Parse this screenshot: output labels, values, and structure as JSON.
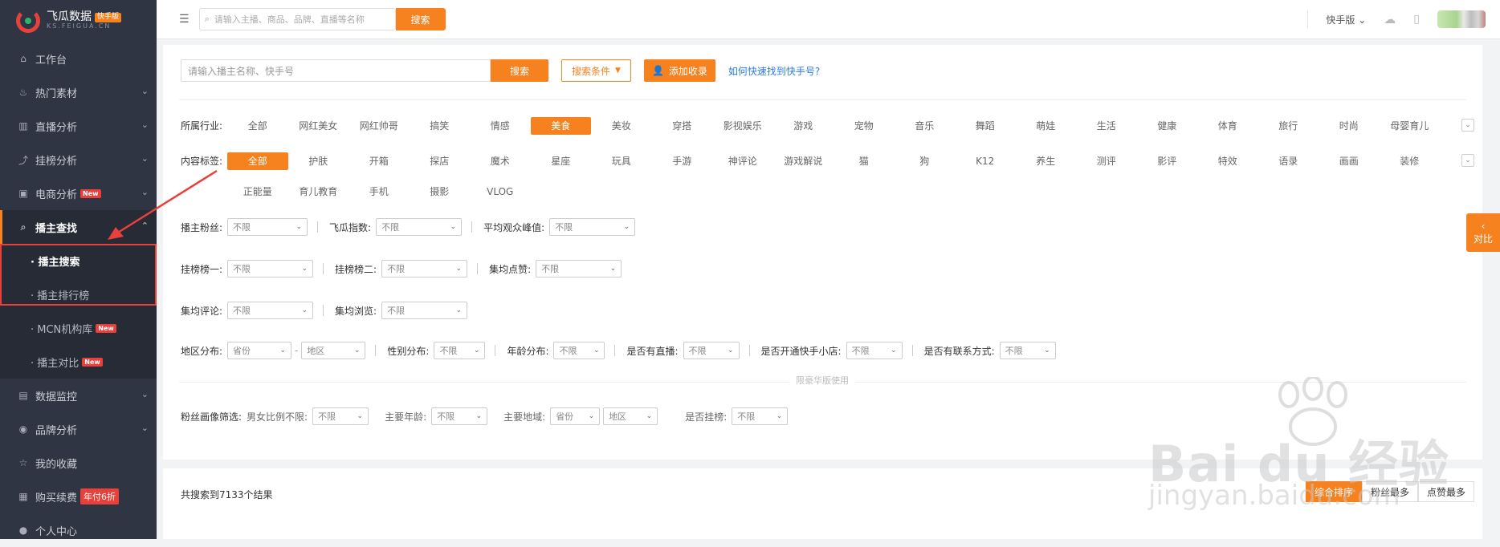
{
  "logo": {
    "title": "飞瓜数据",
    "badge": "快手版",
    "sub": "KS.FEIGUA.CN"
  },
  "sidebar": {
    "items": [
      {
        "label": "工作台",
        "icon": "home-icon",
        "chevron": false
      },
      {
        "label": "热门素材",
        "icon": "flame-icon",
        "chevron": true
      },
      {
        "label": "直播分析",
        "icon": "bar-chart-icon",
        "chevron": true
      },
      {
        "label": "挂榜分析",
        "icon": "trend-icon",
        "chevron": true
      },
      {
        "label": "电商分析",
        "icon": "shop-icon",
        "chevron": true,
        "badge": "New"
      },
      {
        "label": "播主查找",
        "icon": "search-icon",
        "chevron": true,
        "active": true
      }
    ],
    "sub_items": [
      {
        "label": "· 播主搜索",
        "current": true
      },
      {
        "label": "· 播主排行榜"
      },
      {
        "label": "· MCN机构库",
        "badge": "New"
      },
      {
        "label": "· 播主对比",
        "badge": "New"
      }
    ],
    "items2": [
      {
        "label": "数据监控",
        "icon": "monitor-icon",
        "chevron": true
      },
      {
        "label": "品牌分析",
        "icon": "brand-icon",
        "chevron": true
      },
      {
        "label": "我的收藏",
        "icon": "star-icon"
      },
      {
        "label": "购买续费",
        "icon": "cart-icon",
        "badge": "年付6折"
      },
      {
        "label": "个人中心",
        "icon": "user-icon"
      }
    ]
  },
  "topbar": {
    "search_placeholder": "请输入主播、商品、品牌、直播等名称",
    "search_button": "搜索",
    "version": "快手版"
  },
  "search": {
    "placeholder": "请输入播主名称、快手号",
    "button": "搜索",
    "condition_button": "搜索条件",
    "fav_button": "添加收录",
    "help_link": "如何快速找到快手号?"
  },
  "industry": {
    "label": "所属行业:",
    "tags": [
      "全部",
      "网红美女",
      "网红帅哥",
      "搞笑",
      "情感",
      "美食",
      "美妆",
      "穿搭",
      "影视娱乐",
      "游戏",
      "宠物",
      "音乐",
      "舞蹈",
      "萌娃",
      "生活",
      "健康",
      "体育",
      "旅行",
      "时尚",
      "母婴育儿"
    ],
    "selected": 5
  },
  "content_tags": {
    "label": "内容标签:",
    "tags": [
      "全部",
      "护肤",
      "开箱",
      "探店",
      "魔术",
      "星座",
      "玩具",
      "手游",
      "神评论",
      "游戏解说",
      "猫",
      "狗",
      "K12",
      "养生",
      "测评",
      "影评",
      "特效",
      "语录",
      "画画",
      "装修",
      "正能量",
      "育儿教育",
      "手机",
      "摄影",
      "VLOG"
    ],
    "selected": 0
  },
  "filters": {
    "fans": {
      "label": "播主粉丝:",
      "value": "不限"
    },
    "index": {
      "label": "飞瓜指数:",
      "value": "不限"
    },
    "peak": {
      "label": "平均观众峰值:",
      "value": "不限"
    },
    "rank1": {
      "label": "挂榜榜一:",
      "value": "不限"
    },
    "rank2": {
      "label": "挂榜榜二:",
      "value": "不限"
    },
    "likes": {
      "label": "集均点赞:",
      "value": "不限"
    },
    "comments": {
      "label": "集均评论:",
      "value": "不限"
    },
    "views": {
      "label": "集均浏览:",
      "value": "不限"
    },
    "region": {
      "label": "地区分布:",
      "province": "省份",
      "city": "地区"
    },
    "gender": {
      "label": "性别分布:",
      "value": "不限"
    },
    "age": {
      "label": "年龄分布:",
      "value": "不限"
    },
    "live": {
      "label": "是否有直播:",
      "value": "不限"
    },
    "shop": {
      "label": "是否开通快手小店:",
      "value": "不限"
    },
    "contact": {
      "label": "是否有联系方式:",
      "value": "不限"
    }
  },
  "luxury": {
    "text": "限豪华版使用"
  },
  "fan_profile": {
    "label": "粉丝画像筛选:",
    "gender_label": "男女比例不限:",
    "gender_value": "不限",
    "age_label": "主要年龄:",
    "age_value": "不限",
    "region_label": "主要地域:",
    "province": "省份",
    "city": "地区",
    "hang_label": "是否挂榜:",
    "hang_value": "不限"
  },
  "compare_tab": {
    "label": "对比"
  },
  "results": {
    "count_text": "共搜索到7133个结果",
    "sort": [
      "综合排序",
      "粉丝最多",
      "点赞最多"
    ],
    "sort_selected": 0
  },
  "watermark": {
    "main": "Bai du 经验",
    "sub": "jingyan.baidu.com"
  },
  "colors": {
    "accent": "#f5821f",
    "sidebar": "#2f3542",
    "highlight": "#e8413c"
  }
}
